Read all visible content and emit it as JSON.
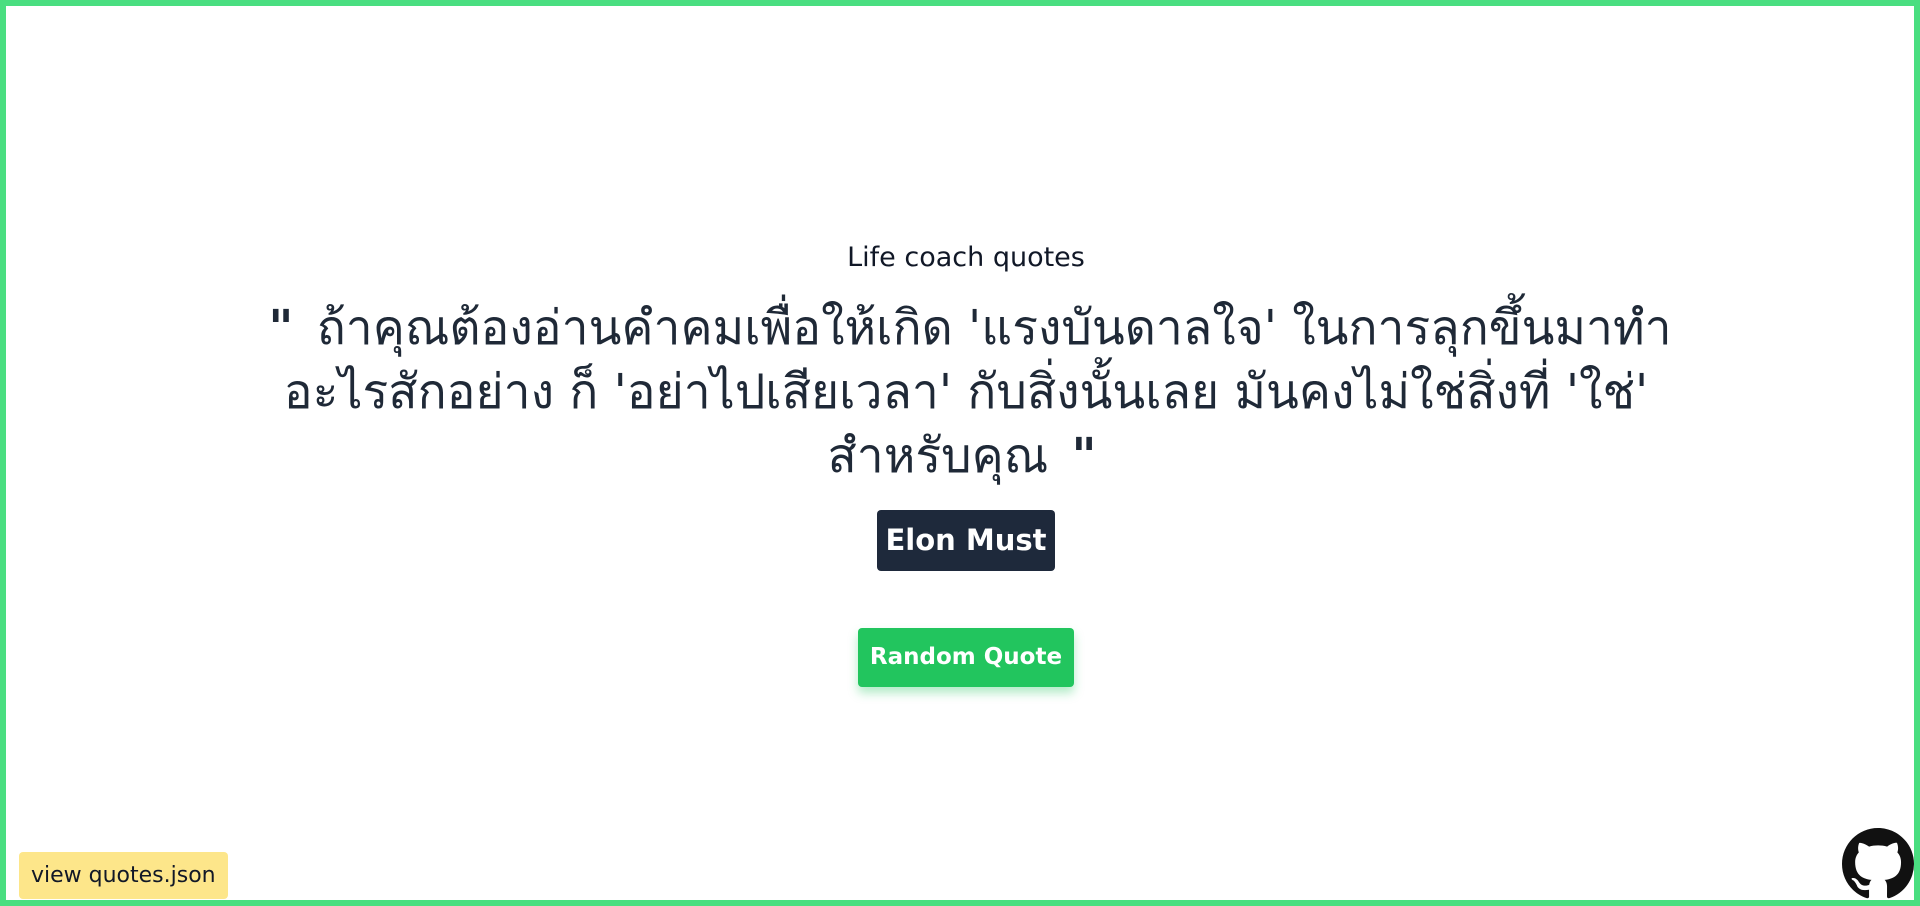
{
  "page": {
    "border_color": "#4ade80"
  },
  "header": {
    "subtitle": "Life coach quotes"
  },
  "quote": {
    "open_mark": "\"",
    "text": "ถ้าคุณต้องอ่านคำคมเพื่อให้เกิด 'แรงบันดาลใจ' ในการลุกขึ้นมาทำอะไรสักอย่าง ก็ 'อย่าไปเสียเวลา' กับสิ่งนั้นเลย มันคงไม่ใช่สิ่งที่ 'ใช่' สำหรับคุณ",
    "close_mark": "\"",
    "author": "Elon Must"
  },
  "actions": {
    "random_label": "Random Quote",
    "view_json_label": "view quotes.json"
  },
  "icons": {
    "github": "github-icon"
  },
  "colors": {
    "accent": "#22c55e",
    "author_bg": "#1e293b",
    "json_link_bg": "#fde68a"
  }
}
